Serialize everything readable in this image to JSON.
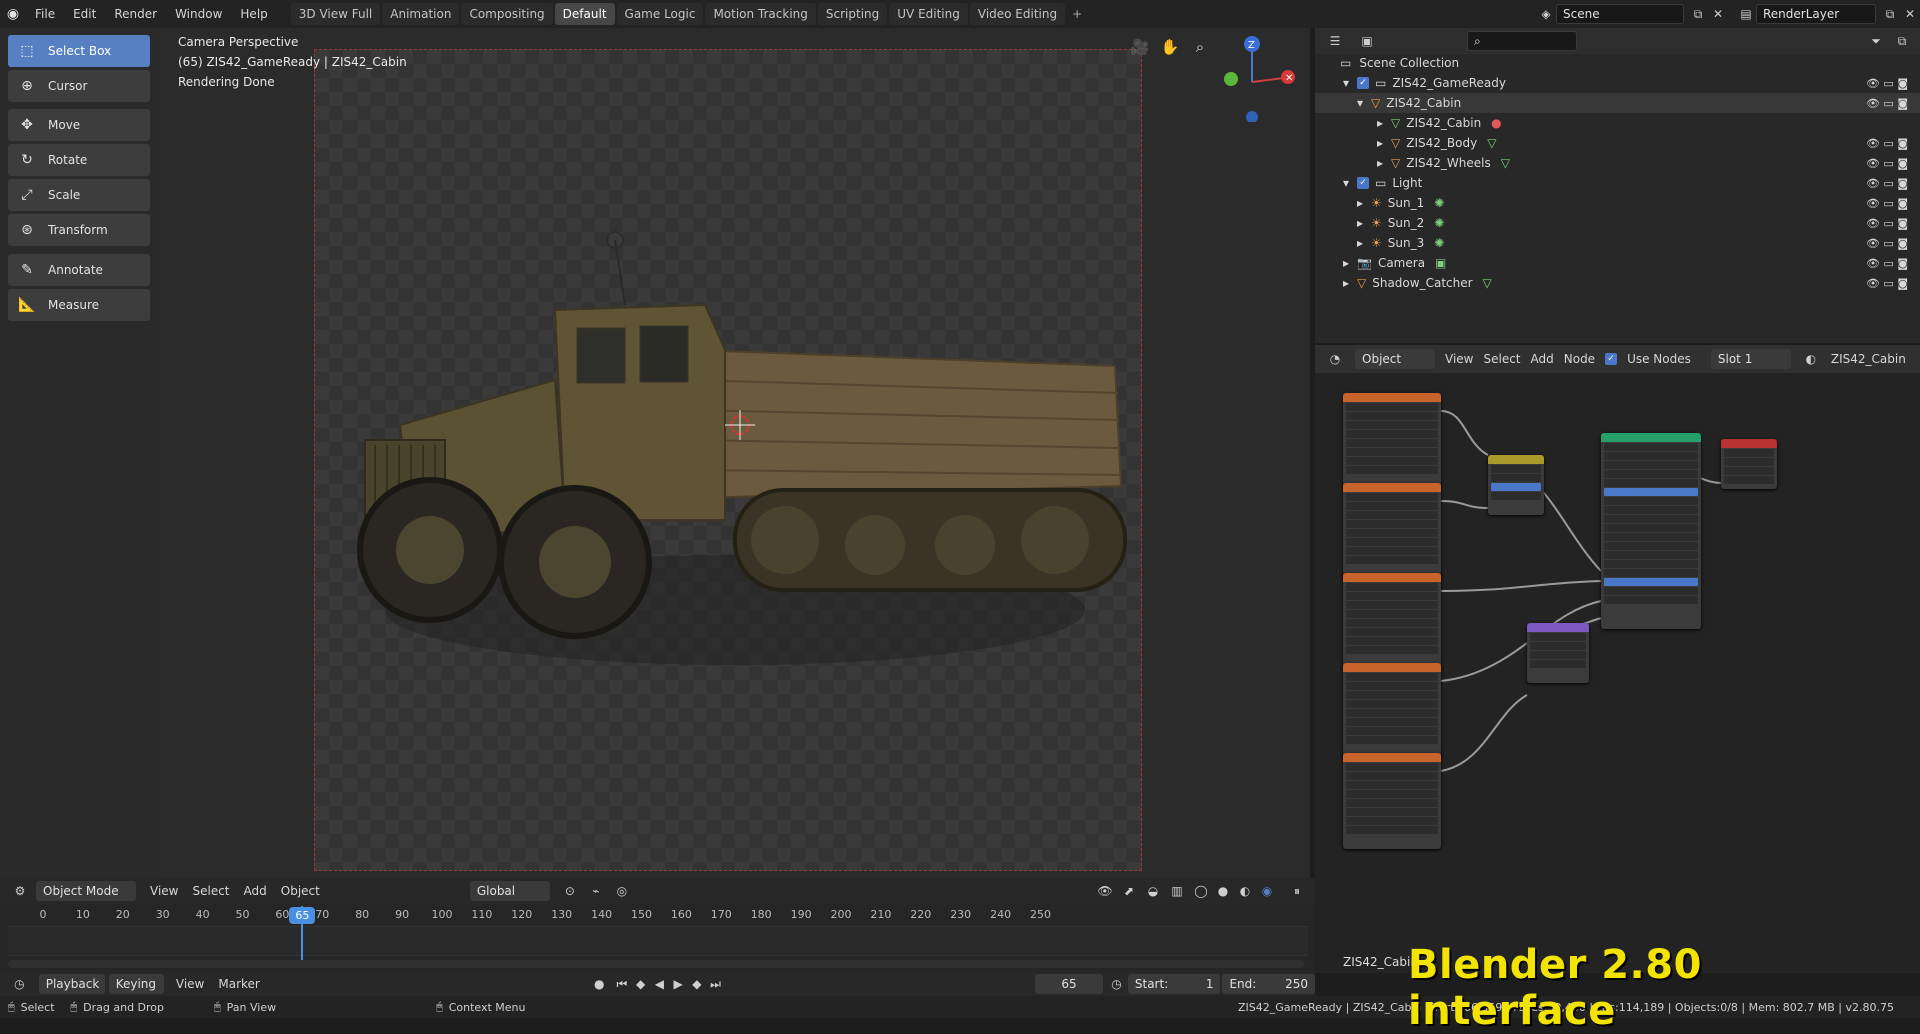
{
  "menu": {
    "items": [
      "File",
      "Edit",
      "Render",
      "Window",
      "Help"
    ]
  },
  "workspaces": {
    "tabs": [
      "3D View Full",
      "Animation",
      "Compositing",
      "Default",
      "Game Logic",
      "Motion Tracking",
      "Scripting",
      "UV Editing",
      "Video Editing"
    ],
    "active": "Default"
  },
  "scene": {
    "name": "Scene",
    "render_layer": "RenderLayer"
  },
  "tools": [
    "Select Box",
    "Cursor",
    "Move",
    "Rotate",
    "Scale",
    "Transform",
    "Annotate",
    "Measure"
  ],
  "viewport": {
    "line1": "Camera Perspective",
    "line2": "(65) ZIS42_GameReady | ZIS42_Cabin",
    "line3": "Rendering Done",
    "axis_z": "Z"
  },
  "outliner": {
    "root": "Scene Collection",
    "rows": [
      "ZIS42_GameReady",
      "ZIS42_Cabin",
      "ZIS42_Cabin",
      "ZIS42_Body",
      "ZIS42_Wheels",
      "Light",
      "Sun_1",
      "Sun_2",
      "Sun_3",
      "Camera",
      "Shadow_Catcher"
    ]
  },
  "node_header": {
    "mode": "Object",
    "view": "View",
    "select": "Select",
    "add": "Add",
    "node": "Node",
    "use_nodes": "Use Nodes",
    "slot": "Slot 1",
    "material": "ZIS42_Cabin"
  },
  "node_editor": {
    "material_label": "ZIS42_Cabin"
  },
  "vp_header": {
    "mode": "Object Mode",
    "view": "View",
    "select": "Select",
    "add": "Add",
    "object": "Object",
    "orientation": "Global"
  },
  "timeline": {
    "ticks": [
      "0",
      "10",
      "20",
      "30",
      "40",
      "50",
      "60",
      "65",
      "70",
      "80",
      "90",
      "100",
      "110",
      "120",
      "130",
      "140",
      "150",
      "160",
      "170",
      "180",
      "190",
      "200",
      "210",
      "220",
      "230",
      "240",
      "250"
    ],
    "current": "65"
  },
  "tl_footer": {
    "playback": "Playback",
    "keying": "Keying",
    "view": "View",
    "marker": "Marker",
    "frame": "65",
    "start_label": "Start:",
    "start": "1",
    "end_label": "End:",
    "end": "250"
  },
  "status": {
    "select": "Select",
    "drag": "Drag and Drop",
    "pan": "Pan View",
    "context": "Context Menu",
    "info": "ZIS42_GameReady | ZIS42_Cabin | Verts:66,359 | Faces:59,480 | Tris:114,189 | Objects:0/8 | Mem: 802.7 MB | v2.80.75"
  },
  "overlay_caption": "Blender 2.80 interface",
  "colors": {
    "accent": "#5680c2",
    "caption": "#f2e400",
    "playhead": "#4a90e2"
  }
}
